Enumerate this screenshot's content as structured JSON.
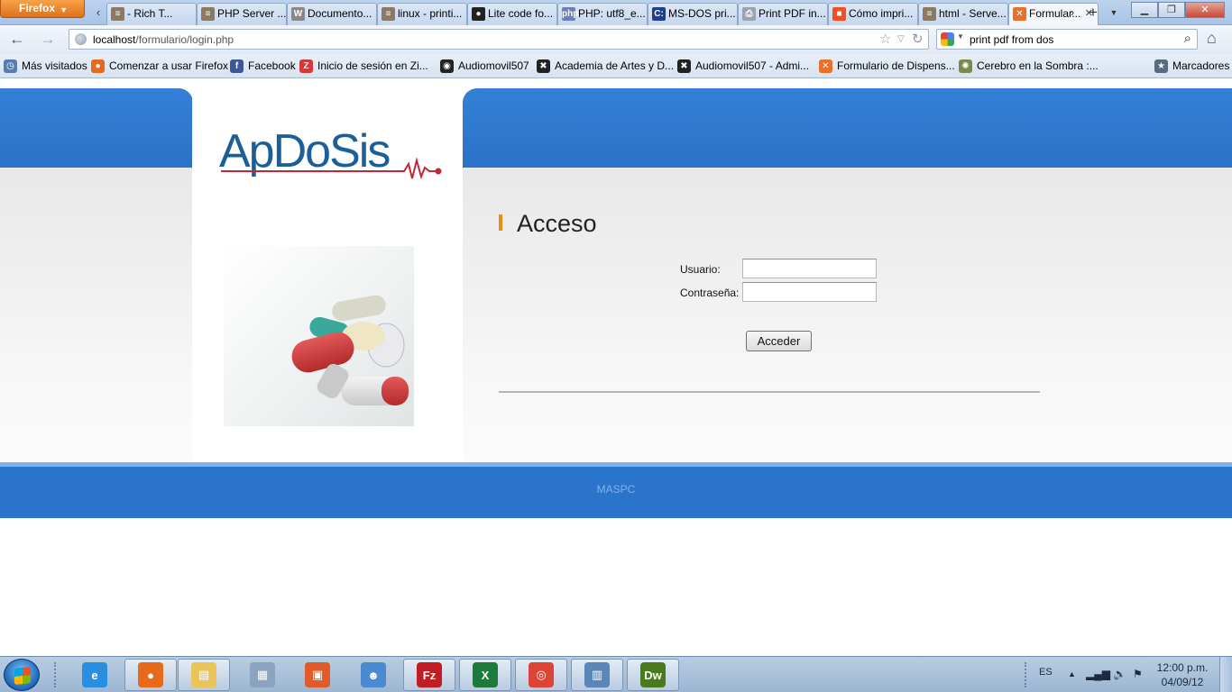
{
  "browser": {
    "firefox_menu_label": "Firefox",
    "tabs": [
      {
        "label": "- Rich T...",
        "icon": "stackoverflow-icon",
        "color": "#8a7a62",
        "glyph": "≡"
      },
      {
        "label": "PHP Server ...",
        "icon": "stackoverflow-icon",
        "color": "#8a7a62",
        "glyph": "≡"
      },
      {
        "label": "Documento...",
        "icon": "wikipedia-icon",
        "color": "#888888",
        "glyph": "W"
      },
      {
        "label": "linux - printi...",
        "icon": "stackoverflow-icon",
        "color": "#8a7a62",
        "glyph": "≡"
      },
      {
        "label": "Lite code fo...",
        "icon": "github-icon",
        "color": "#222222",
        "glyph": "●"
      },
      {
        "label": "PHP: utf8_e...",
        "icon": "php-icon",
        "color": "#6c7eb7",
        "glyph": "php"
      },
      {
        "label": "MS-DOS pri...",
        "icon": "cmd-icon",
        "color": "#1f3f8c",
        "glyph": "C:"
      },
      {
        "label": "Print PDF in...",
        "icon": "printer-icon",
        "color": "#9aa2ad",
        "glyph": "⎙"
      },
      {
        "label": "Cómo impri...",
        "icon": "microsoft-icon",
        "color": "#f25022",
        "glyph": "■"
      },
      {
        "label": "html - Serve...",
        "icon": "stackoverflow-icon",
        "color": "#8a7a62",
        "glyph": "≡"
      },
      {
        "label": "Formular...",
        "icon": "xampp-icon",
        "color": "#e8702a",
        "glyph": "✕",
        "active": true
      }
    ],
    "url_host": "localhost",
    "url_path": "/formulario/login.php",
    "search_text": "print pdf from dos",
    "bookmarks": [
      {
        "label": "Más visitados",
        "icon": "most-visited-icon",
        "color": "#5a7db0",
        "glyph": "◷"
      },
      {
        "label": "Comenzar a usar Firefox",
        "icon": "firefox-icon",
        "color": "#e66a1c",
        "glyph": "●"
      },
      {
        "label": "Facebook",
        "icon": "facebook-icon",
        "color": "#3b5998",
        "glyph": "f"
      },
      {
        "label": "Inicio de sesión en Zi...",
        "icon": "zimbra-icon",
        "color": "#d03a3a",
        "glyph": "Z"
      },
      {
        "label": "Audiomovil507",
        "icon": "audiomovil-icon",
        "color": "#222222",
        "glyph": "◉"
      },
      {
        "label": "Academia de Artes y D...",
        "icon": "joomla-icon",
        "color": "#222222",
        "glyph": "✖"
      },
      {
        "label": "Audiomovil507 - Admi...",
        "icon": "joomla-icon",
        "color": "#222222",
        "glyph": "✖"
      },
      {
        "label": "Formulario de Dispens...",
        "icon": "xampp-icon",
        "color": "#e8702a",
        "glyph": "✕"
      },
      {
        "label": "Cerebro en la Sombra :...",
        "icon": "cerebro-icon",
        "color": "#7a8a4a",
        "glyph": "✺"
      }
    ],
    "bookmarks_menu_label": "Marcadores"
  },
  "page": {
    "logo_text": "ApDoSis",
    "title": "Acceso",
    "usuario_label": "Usuario:",
    "password_label": "Contraseña:",
    "usuario_value": "",
    "password_value": "",
    "submit_label": "Acceder",
    "footer_text": "MASPC",
    "colors": {
      "brand_blue": "#2b74cc",
      "accent_orange": "#f08a10",
      "logo_red": "#c0283a"
    }
  },
  "taskbar": {
    "apps": [
      {
        "name": "internet-explorer-icon",
        "color": "#2a8ee0",
        "glyph": "e",
        "open": false
      },
      {
        "name": "firefox-icon",
        "color": "#e66a1c",
        "glyph": "●",
        "open": true
      },
      {
        "name": "file-explorer-icon",
        "color": "#e9c45a",
        "glyph": "▤",
        "open": true
      },
      {
        "name": "calculator-icon",
        "color": "#8ca3bf",
        "glyph": "▦",
        "open": false
      },
      {
        "name": "installer-icon",
        "color": "#e05a2a",
        "glyph": "▣",
        "open": false
      },
      {
        "name": "users-icon",
        "color": "#4a8ad0",
        "glyph": "☻",
        "open": false
      },
      {
        "name": "filezilla-icon",
        "color": "#bf1e24",
        "glyph": "Fz",
        "open": true
      },
      {
        "name": "excel-icon",
        "color": "#1e7a3c",
        "glyph": "X",
        "open": true
      },
      {
        "name": "chrome-icon",
        "color": "#db4437",
        "glyph": "◎",
        "open": true
      },
      {
        "name": "control-panel-icon",
        "color": "#5b86b8",
        "glyph": "▥",
        "open": true
      },
      {
        "name": "dreamweaver-icon",
        "color": "#4a7a1e",
        "glyph": "Dw",
        "open": true
      }
    ],
    "language": "ES",
    "time": "12:00 p.m.",
    "date": "04/09/12"
  }
}
